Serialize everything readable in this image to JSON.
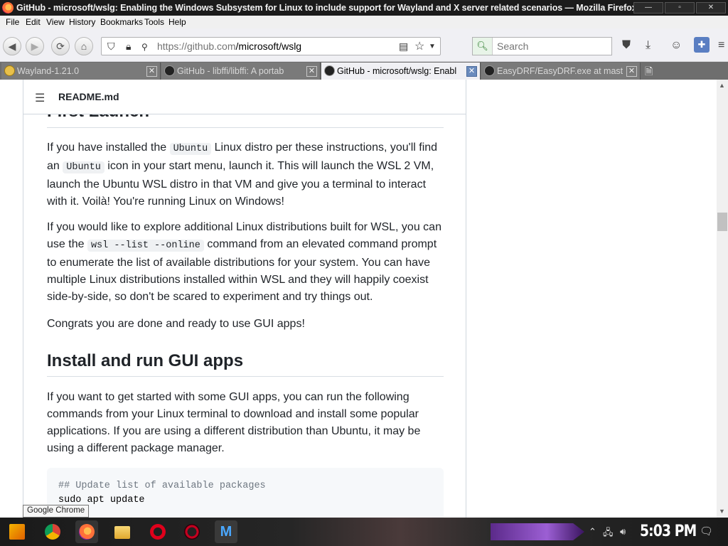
{
  "window": {
    "title": "GitHub - microsoft/wslg: Enabling the Windows Subsystem for Linux to include support for Wayland and X server related scenarios — Mozilla Firefox"
  },
  "menubar": {
    "items": [
      "File",
      "Edit",
      "View",
      "History",
      "Bookmarks",
      "Tools",
      "Help"
    ]
  },
  "navbar": {
    "url_host": "https://github.com",
    "url_path": "/microsoft/wslg",
    "search_placeholder": "Search"
  },
  "tabs": [
    {
      "label": "Wayland-1.21.0",
      "active": false
    },
    {
      "label": "GitHub - libffi/libffi: A portab",
      "active": false
    },
    {
      "label": "GitHub - microsoft/wslg: Enabl",
      "active": true
    },
    {
      "label": "EasyDRF/EasyDRF.exe at mast",
      "active": false
    }
  ],
  "readme": {
    "filename": "README.md",
    "prev_heading": "First Launch",
    "p1": {
      "a": "If you have installed the ",
      "code1": "Ubuntu",
      "b": " Linux distro per these instructions, you'll find an ",
      "code2": "Ubuntu",
      "c": " icon in your start menu, launch it. This will launch the WSL 2 VM, launch the Ubuntu WSL distro in that VM and give you a terminal to interact with it. Voilà! You're running Linux on Windows!"
    },
    "p2": {
      "a": "If you would like to explore additional Linux distributions built for WSL, you can use the ",
      "code": "wsl --list --online",
      "b": " command from an elevated command prompt to enumerate the list of available distributions for your system. You can have multiple Linux distributions installed within WSL and they will happily coexist side-by-side, so don't be scared to experiment and try things out."
    },
    "p3": "Congrats you are done and ready to use GUI apps!",
    "h2": "Install and run GUI apps",
    "p4": "If you want to get started with some GUI apps, you can run the following commands from your Linux terminal to download and install some popular applications. If you are using a different distribution than Ubuntu, it may be using a different package manager.",
    "code_lines": [
      "## Update list of available packages",
      "sudo apt update"
    ]
  },
  "tooltip": "Google Chrome",
  "taskbar": {
    "clock": "5:03 PM"
  },
  "colors": {
    "link_blue": "#0969da",
    "text": "#1f2328",
    "code_bg": "#f6f8fa",
    "active_tab_close": "#6a8bbd"
  }
}
